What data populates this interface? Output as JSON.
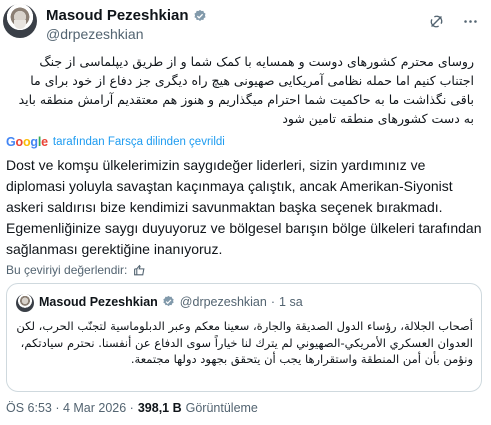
{
  "author": {
    "display_name": "Masoud Pezeshkian",
    "handle": "@drpezeshkian"
  },
  "icons": {
    "verified": "verified-badge-icon",
    "grok": "grok-icon",
    "more": "more-icon",
    "translate_rate": "translate-rate-icon"
  },
  "colors": {
    "link": "#1d9bf0",
    "secondary_text": "#536471",
    "border": "#cfd9de"
  },
  "tweet": {
    "original_text": "روسای محترم کشورهای دوست و همسایه با کمک شما و از طریق دیپلماسی از جنگ اجتناب کنیم اما حمله نظامی آمریکایی صهیونی هیچ راه دیگری جز دفاع از خود برای ما باقی نگذاشت ما به حاکمیت شما احترام میگذاریم و هنوز هم معتقدیم آرامش منطقه باید به دست کشورهای منطقه تامین شود",
    "translation_source_label": "tarafından Farsça dilinden çevrildi",
    "translated_text": "Dost ve komşu ülkelerimizin saygıdeğer liderleri, sizin yardımınız ve diplomasi yoluyla savaştan kaçınmaya çalıştık, ancak Amerikan-Siyonist askeri saldırısı bize kendimizi savunmaktan başka seçenek bırakmadı. Egemenliğinize saygı duyuyoruz ve bölgesel barışın bölge ülkeleri tarafından sağlanması gerektiğine inanıyoruz.",
    "rate_translation_label": "Bu çeviriyi değerlendir:"
  },
  "quote": {
    "display_name": "Masoud Pezeshkian",
    "handle": "@drpezeshkian",
    "separator": "·",
    "time": "1 sa",
    "text": "أصحاب الجلالة، رؤساء الدول الصديقة والجارة، سعينا معكم وعبر الدبلوماسية لتجنّب الحرب، لكن العدوان العسكري الأمريكي-الصهيوني لم يترك لنا خياراً سوى الدفاع عن أنفسنا. نحترم سيادتكم، ونؤمن بأن أمن المنطقة واستقرارها يجب أن يتحقق بجهود دولها مجتمعة."
  },
  "meta": {
    "time": "ÖS 6:53 · 4 Mar 2026 ·",
    "views": "398,1 B",
    "views_label": "Görüntüleme"
  }
}
